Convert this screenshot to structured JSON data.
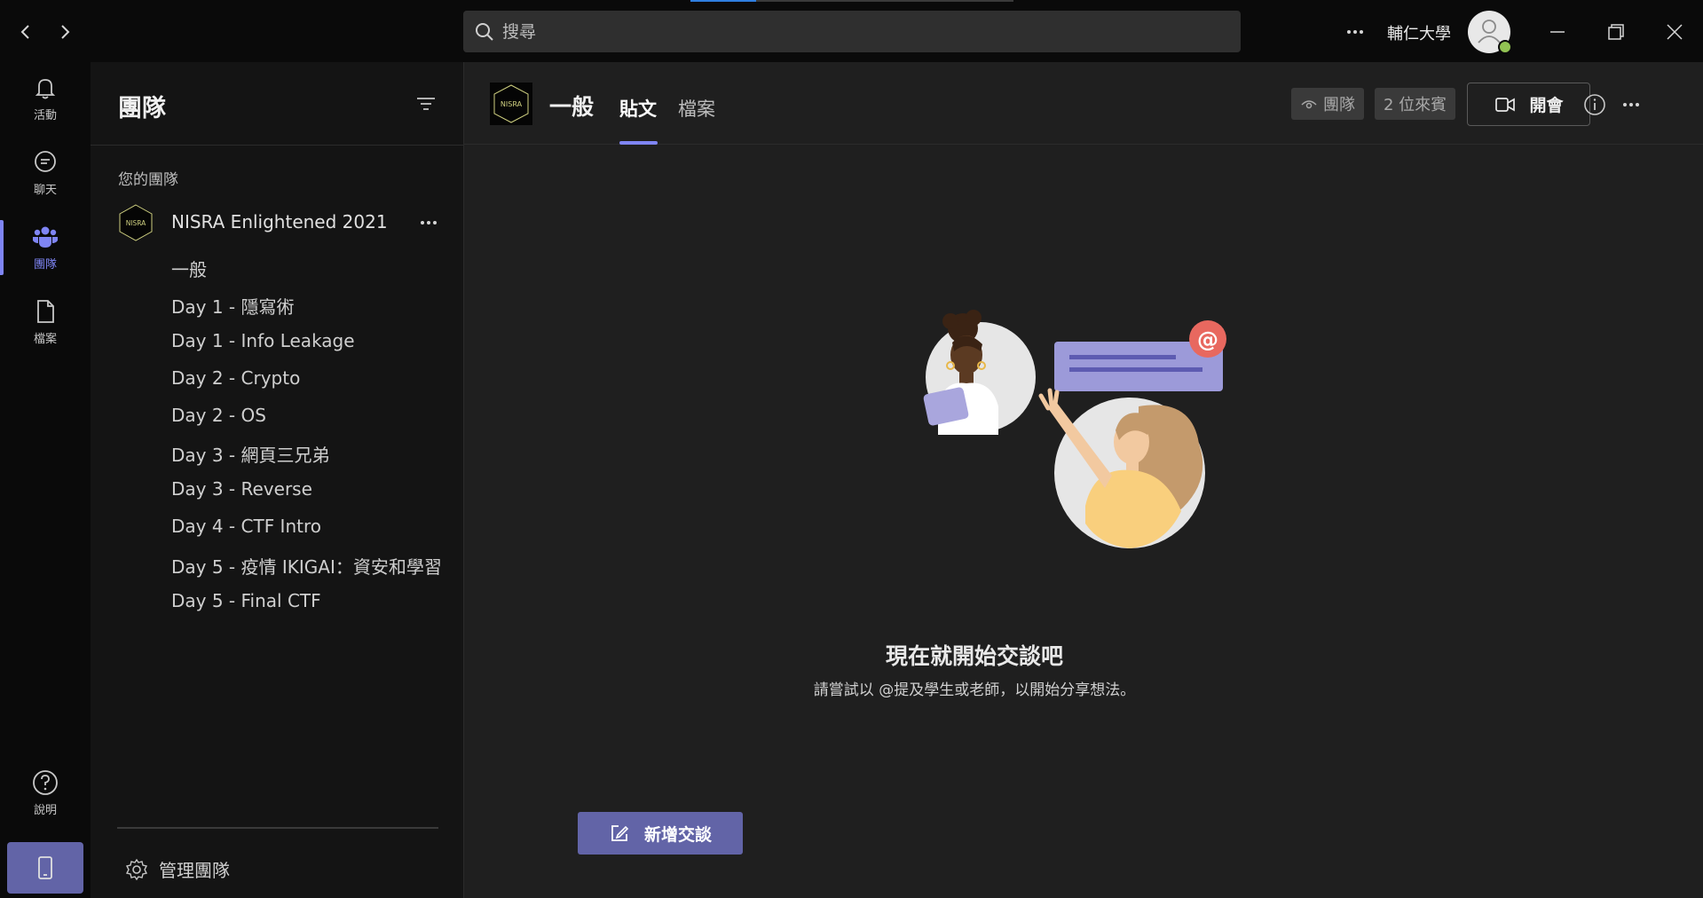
{
  "titlebar": {
    "search_placeholder": "搜尋",
    "org_name": "輔仁大學",
    "back_icon": "chevron-left-icon",
    "forward_icon": "chevron-right-icon"
  },
  "rail": {
    "items": [
      {
        "label": "活動",
        "icon": "bell-icon"
      },
      {
        "label": "聊天",
        "icon": "chat-icon"
      },
      {
        "label": "團隊",
        "icon": "teams-icon",
        "active": true
      },
      {
        "label": "檔案",
        "icon": "file-icon"
      },
      {
        "label": "說明",
        "icon": "help-icon"
      }
    ]
  },
  "panel": {
    "title": "團隊",
    "section_label": "您的團隊",
    "team": {
      "name": "NISRA Enlightened 2021",
      "logo_text": "NISRA",
      "channels": [
        "一般",
        "Day 1 - 隱寫術",
        "Day 1 - Info Leakage",
        "Day 2 - Crypto",
        "Day 2 - OS",
        "Day 3 - 網頁三兄弟",
        "Day 3 - Reverse",
        "Day 4 - CTF Intro",
        "Day 5 - 疫情 IKIGAI：資安和學習",
        "Day 5 - Final CTF"
      ]
    },
    "manage_label": "管理團隊"
  },
  "channel": {
    "title": "一般",
    "logo_text": "NISRA",
    "tabs": [
      {
        "label": "貼文",
        "active": true
      },
      {
        "label": "檔案",
        "active": false
      }
    ],
    "team_pill": "團隊",
    "guests_pill": "2 位來賓",
    "meet_label": "開會"
  },
  "empty_state": {
    "title": "現在就開始交談吧",
    "subtitle": "請嘗試以 @提及學生或老師，以開始分享想法。",
    "new_conversation_label": "新增交談"
  },
  "colors": {
    "accent": "#7f85f5",
    "button": "#6264a7",
    "presence": "#92c353",
    "mention": "#e8685f"
  }
}
